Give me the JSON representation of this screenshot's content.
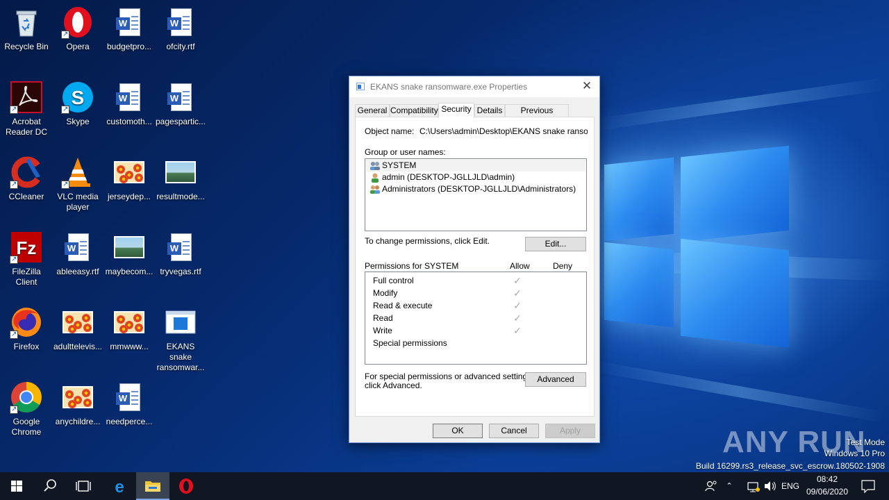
{
  "desktop": {
    "icons": [
      {
        "label": "Recycle Bin",
        "icon": "recycle-bin-icon"
      },
      {
        "label": "Opera",
        "icon": "opera-icon"
      },
      {
        "label": "budgetpro...",
        "icon": "word-document-icon"
      },
      {
        "label": "ofcity.rtf",
        "icon": "word-document-icon"
      },
      {
        "label": "Acrobat Reader DC",
        "icon": "acrobat-icon"
      },
      {
        "label": "Skype",
        "icon": "skype-icon"
      },
      {
        "label": "customoth...",
        "icon": "word-document-icon"
      },
      {
        "label": "pagespartic...",
        "icon": "word-document-icon"
      },
      {
        "label": "CCleaner",
        "icon": "ccleaner-icon"
      },
      {
        "label": "VLC media player",
        "icon": "vlc-icon"
      },
      {
        "label": "jerseydep...",
        "icon": "image-icon"
      },
      {
        "label": "resultmode...",
        "icon": "image-icon"
      },
      {
        "label": "FileZilla Client",
        "icon": "filezilla-icon"
      },
      {
        "label": "ableeasy.rtf",
        "icon": "word-document-icon"
      },
      {
        "label": "maybecom...",
        "icon": "image-icon"
      },
      {
        "label": "tryvegas.rtf",
        "icon": "word-document-icon"
      },
      {
        "label": "Firefox",
        "icon": "firefox-icon"
      },
      {
        "label": "adulttelevis...",
        "icon": "image-icon"
      },
      {
        "label": "mmwww...",
        "icon": "image-icon"
      },
      {
        "label": "EKANS snake ransomwar...",
        "icon": "executable-icon"
      },
      {
        "label": "Google Chrome",
        "icon": "chrome-icon"
      },
      {
        "label": "anychildre...",
        "icon": "image-icon"
      },
      {
        "label": "needperce...",
        "icon": "word-document-icon"
      }
    ]
  },
  "dialog": {
    "title": "EKANS snake ransomware.exe Properties",
    "close_glyph": "✕",
    "tabs": [
      "General",
      "Compatibility",
      "Security",
      "Details",
      "Previous Versions"
    ],
    "active_tab": "Security",
    "object_name_label": "Object name:",
    "object_name_value": "C:\\Users\\admin\\Desktop\\EKANS snake ransomw...",
    "group_label": "Group or user names:",
    "groups": [
      "SYSTEM",
      "admin (DESKTOP-JGLLJLD\\admin)",
      "Administrators (DESKTOP-JGLLJLD\\Administrators)"
    ],
    "change_hint": "To change permissions, click Edit.",
    "edit_button": "Edit...",
    "permissions_label": "Permissions for SYSTEM",
    "allow_header": "Allow",
    "deny_header": "Deny",
    "permissions": [
      {
        "name": "Full control",
        "allow": true
      },
      {
        "name": "Modify",
        "allow": true
      },
      {
        "name": "Read & execute",
        "allow": true
      },
      {
        "name": "Read",
        "allow": true
      },
      {
        "name": "Write",
        "allow": true
      },
      {
        "name": "Special permissions",
        "allow": false
      }
    ],
    "advanced_hint_line1": "For special permissions or advanced settings,",
    "advanced_hint_line2": "click Advanced.",
    "advanced_button": "Advanced",
    "ok_button": "OK",
    "cancel_button": "Cancel",
    "apply_button": "Apply"
  },
  "watermark": {
    "brand": "ANY RUN",
    "line1": "Test Mode",
    "line2": "Windows 10 Pro",
    "line3": "Build 16299.rs3_release_svc_escrow.180502-1908"
  },
  "taskbar": {
    "language": "ENG",
    "time": "08:42",
    "date": "09/06/2020"
  },
  "colors": {
    "accent": "#2b79d6",
    "taskbar": "#101722",
    "dialog_bg": "#f0f0f0"
  }
}
